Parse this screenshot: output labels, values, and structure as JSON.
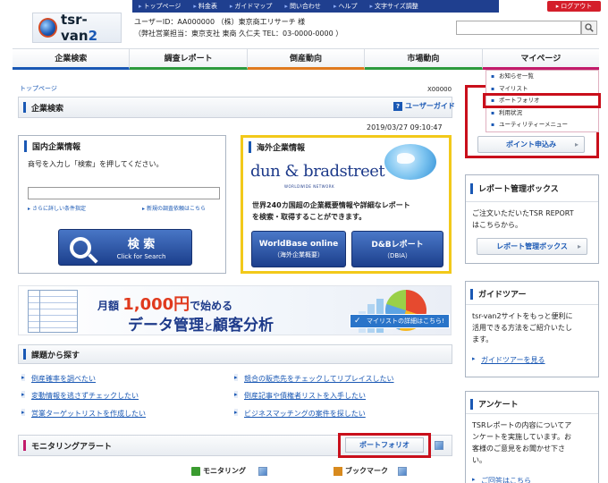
{
  "header": {
    "top_links": [
      "トップページ",
      "料金表",
      "ガイドマップ",
      "問い合わせ",
      "ヘルプ",
      "文字サイズ調整"
    ],
    "logout_label": "ログアウト",
    "logo_text": "tsr-van",
    "logo_suffix": "2",
    "user_line1": "ユーザーID：AA000000 （株）東京商工リサーチ 様",
    "user_line2": "（弊社営業担当：東京支社 東商 久仁夫 TEL：03-0000-0000 ）",
    "search_placeholder": ""
  },
  "main_nav": [
    {
      "label": "企業検索",
      "color": "#1a58b4"
    },
    {
      "label": "調査レポート",
      "color": "#2d9a3d"
    },
    {
      "label": "倒産動向",
      "color": "#e07a1f"
    },
    {
      "label": "市場動向",
      "color": "#2d9a3d"
    },
    {
      "label": "マイページ",
      "color": "#c21b6b"
    }
  ],
  "mypage_menu": [
    "お知らせ一覧",
    "マイリスト",
    "ポートフォリオ",
    "利用状況",
    "ユーティリティーメニュー"
  ],
  "point_button_label": "ポイント申込み",
  "breadcrumb": "トップページ",
  "page_code": "X00000",
  "page_section": {
    "title": "企業検索",
    "guide_link": "ユーザーガイド",
    "datetime": "2019/03/27 09:10:47"
  },
  "domestic": {
    "title": "国内企業情報",
    "desc": "商号を入力し「検索」を押してください。",
    "input_value": "",
    "link_detail": "さらに詳しい条件指定",
    "link_new": "新規の調査依頼はこちら",
    "search_label": "検 索",
    "search_sub": "Click for Search"
  },
  "overseas": {
    "title": "海外企業情報",
    "logo": "dun & bradstreet",
    "logo_sub": "WORLDWIDE NETWORK",
    "desc1": "世界240カ国超の企業概要情報や詳細なレポート",
    "desc2": "を検索・取得することができます。",
    "btn1_a": "WorldBase online",
    "btn1_b": "（海外企業概要）",
    "btn2_a": "D&Bレポート",
    "btn2_b": "（DBIA）"
  },
  "banner": {
    "line1_pre": "月額",
    "line1_num": "1,000円",
    "line1_post": "で始める",
    "line2_a": "データ管理",
    "line2_b": "と",
    "line2_c": "顧客分析",
    "cta": "マイリストの詳細はこちら!"
  },
  "issues": {
    "title": "課題から探す",
    "items": [
      "倒産確率を調べたい",
      "競合の販売先をチェックしてリプレイスしたい",
      "変動情報を逃さずチェックしたい",
      "倒産記事や債権者リストを入手したい",
      "営業ターゲットリストを作成したい",
      "ビジネスマッチングの案件を探したい"
    ]
  },
  "monitoring": {
    "title": "モニタリングアラート",
    "portfolio_button": "ポートフォリオ",
    "tab_monitoring": "モニタリング",
    "tab_bookmark": "ブックマーク"
  },
  "report_box": {
    "title": "レポート管理ボックス",
    "text1": "ご注文いただいたTSR REPORT",
    "text2": "はこちらから。",
    "button": "レポート管理ボックス"
  },
  "guide_tour": {
    "title": "ガイドツアー",
    "text1": "tsr-van2サイトをもっと便利に",
    "text2": "活用できる方法をご紹介いたし",
    "text3": "ます。",
    "link": "ガイドツアーを見る"
  },
  "survey": {
    "title": "アンケート",
    "text1": "TSRレポートの内容についてア",
    "text2": "ンケートを実施しています。お",
    "text3": "客様のご意見をお聞かせ下さ",
    "text4": "い。",
    "link": "ご回答はこちら"
  },
  "colors": {
    "accent": "#1a58b4",
    "highlight": "#c90f1b",
    "overseas_border": "#f2c91a"
  }
}
